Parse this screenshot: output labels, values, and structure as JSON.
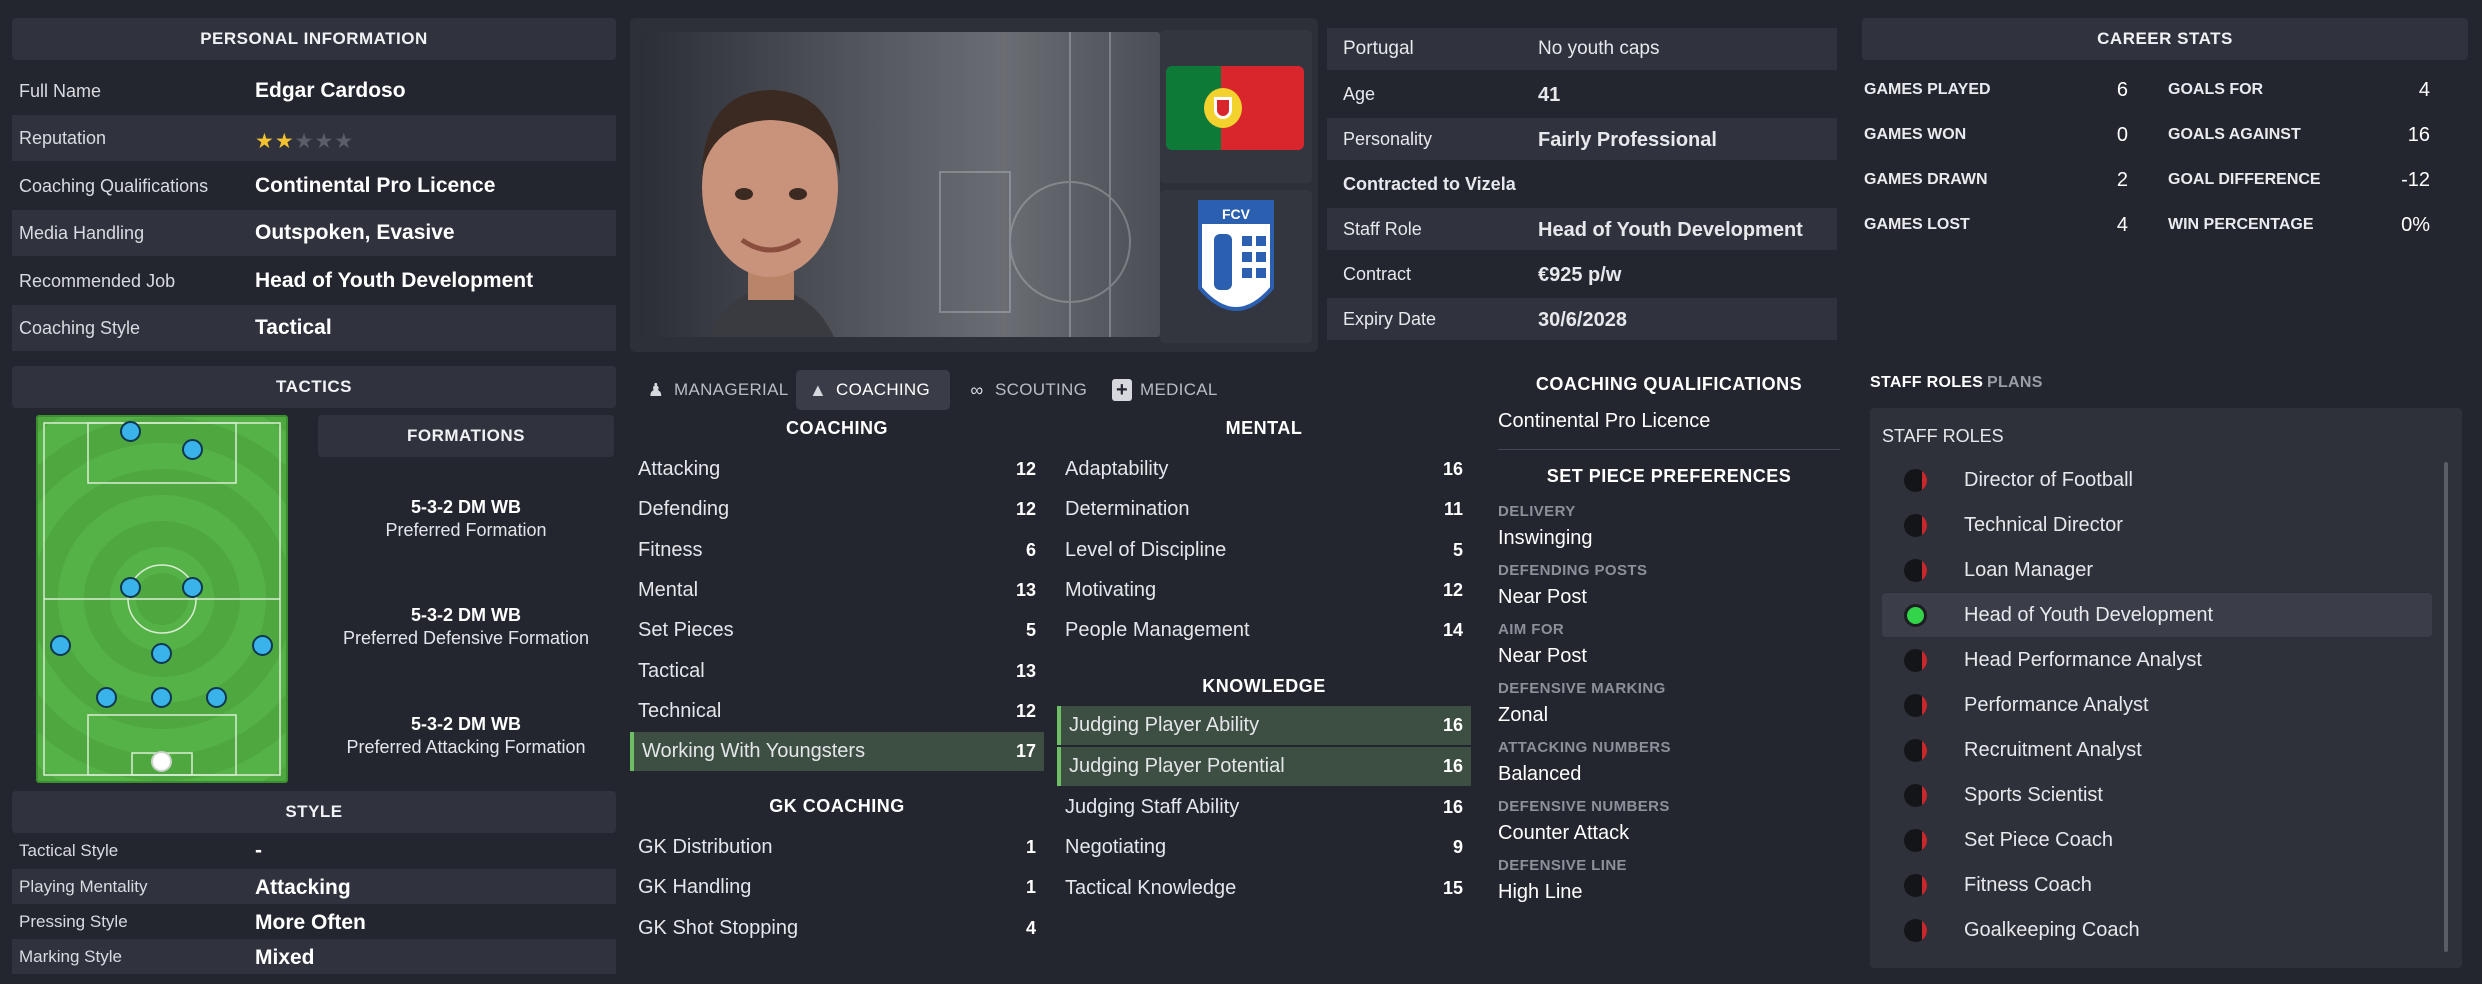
{
  "personal": {
    "header": "PERSONAL INFORMATION",
    "rows": [
      {
        "label": "Full Name",
        "value": "Edgar Cardoso"
      },
      {
        "label": "Reputation",
        "stars_filled": 2,
        "stars_total": 5
      },
      {
        "label": "Coaching Qualifications",
        "value": "Continental Pro Licence"
      },
      {
        "label": "Media Handling",
        "value": "Outspoken, Evasive"
      },
      {
        "label": "Recommended Job",
        "value": "Head of Youth Development"
      },
      {
        "label": "Coaching Style",
        "value": "Tactical"
      }
    ]
  },
  "profile": {
    "flag_colors": {
      "green": "#0e7a37",
      "red": "#d9262c"
    },
    "club_badge": "vizela-crest-icon"
  },
  "details": {
    "nation": "Portugal",
    "youth_caps": "No youth caps",
    "age_label": "Age",
    "age": "41",
    "personality_label": "Personality",
    "personality": "Fairly Professional",
    "contracted": "Contracted to Vizela",
    "role_label": "Staff Role",
    "role": "Head of Youth Development",
    "contract_label": "Contract",
    "contract": "€925 p/w",
    "expiry_label": "Expiry Date",
    "expiry": "30/6/2028"
  },
  "career": {
    "header": "CAREER STATS",
    "left": [
      {
        "label": "GAMES PLAYED",
        "value": "6"
      },
      {
        "label": "GAMES WON",
        "value": "0"
      },
      {
        "label": "GAMES DRAWN",
        "value": "2"
      },
      {
        "label": "GAMES LOST",
        "value": "4"
      }
    ],
    "right": [
      {
        "label": "GOALS FOR",
        "value": "4"
      },
      {
        "label": "GOALS AGAINST",
        "value": "16"
      },
      {
        "label": "GOAL DIFFERENCE",
        "value": "-12"
      },
      {
        "label": "WIN PERCENTAGE",
        "value": "0%"
      }
    ]
  },
  "tactics": {
    "header": "TACTICS",
    "formations_header": "FORMATIONS",
    "formations": [
      {
        "name": "5-3-2 DM WB",
        "desc": "Preferred Formation"
      },
      {
        "name": "5-3-2 DM WB",
        "desc": "Preferred Defensive Formation"
      },
      {
        "name": "5-3-2 DM WB",
        "desc": "Preferred Attacking Formation"
      }
    ],
    "pitch_color": "#4ea83f"
  },
  "style": {
    "header": "STYLE",
    "rows": [
      {
        "label": "Tactical Style",
        "value": "-"
      },
      {
        "label": "Playing Mentality",
        "value": "Attacking"
      },
      {
        "label": "Pressing Style",
        "value": "More Often"
      },
      {
        "label": "Marking Style",
        "value": "Mixed"
      }
    ]
  },
  "tabs": [
    {
      "label": "MANAGERIAL",
      "icon": "manager-icon"
    },
    {
      "label": "COACHING",
      "icon": "coach-icon",
      "active": true
    },
    {
      "label": "SCOUTING",
      "icon": "binoculars-icon"
    },
    {
      "label": "MEDICAL",
      "icon": "medical-kit-icon"
    }
  ],
  "attributes": {
    "coaching_header": "COACHING",
    "coaching": [
      {
        "label": "Attacking",
        "value": "12",
        "tone": "b"
      },
      {
        "label": "Defending",
        "value": "12",
        "tone": "b"
      },
      {
        "label": "Fitness",
        "value": "6",
        "tone": "w"
      },
      {
        "label": "Mental",
        "value": "13",
        "tone": "b"
      },
      {
        "label": "Set Pieces",
        "value": "5",
        "tone": "g"
      },
      {
        "label": "Tactical",
        "value": "13",
        "tone": "b"
      },
      {
        "label": "Technical",
        "value": "12",
        "tone": "b"
      },
      {
        "label": "Working With Youngsters",
        "value": "17",
        "tone": "w",
        "hl": true
      }
    ],
    "gk_header": "GK COACHING",
    "gk": [
      {
        "label": "GK Distribution",
        "value": "1",
        "tone": "g"
      },
      {
        "label": "GK Handling",
        "value": "1",
        "tone": "g"
      },
      {
        "label": "GK Shot Stopping",
        "value": "4",
        "tone": "g"
      }
    ],
    "mental_header": "MENTAL",
    "mental": [
      {
        "label": "Adaptability",
        "value": "16",
        "tone": "b"
      },
      {
        "label": "Determination",
        "value": "11",
        "tone": "b"
      },
      {
        "label": "Level of Discipline",
        "value": "5",
        "tone": "g"
      },
      {
        "label": "Motivating",
        "value": "12",
        "tone": "b"
      },
      {
        "label": "People Management",
        "value": "14",
        "tone": "b"
      }
    ],
    "knowledge_header": "KNOWLEDGE",
    "knowledge": [
      {
        "label": "Judging Player Ability",
        "value": "16",
        "tone": "b",
        "hl": true
      },
      {
        "label": "Judging Player Potential",
        "value": "16",
        "tone": "b",
        "hl": true
      },
      {
        "label": "Judging Staff Ability",
        "value": "16",
        "tone": "b"
      },
      {
        "label": "Negotiating",
        "value": "9",
        "tone": "w"
      },
      {
        "label": "Tactical Knowledge",
        "value": "15",
        "tone": "b"
      }
    ]
  },
  "qualifications": {
    "header": "COACHING QUALIFICATIONS",
    "value": "Continental Pro Licence",
    "setpiece_header": "SET PIECE PREFERENCES",
    "items": [
      {
        "label": "DELIVERY",
        "value": "Inswinging"
      },
      {
        "label": "DEFENDING POSTS",
        "value": "Near Post"
      },
      {
        "label": "AIM FOR",
        "value": "Near Post"
      },
      {
        "label": "DEFENSIVE MARKING",
        "value": "Zonal"
      },
      {
        "label": "ATTACKING NUMBERS",
        "value": "Balanced"
      },
      {
        "label": "DEFENSIVE NUMBERS",
        "value": "Counter Attack"
      },
      {
        "label": "DEFENSIVE LINE",
        "value": "High Line"
      }
    ]
  },
  "staff": {
    "tabs": [
      "STAFF ROLES",
      "PLANS"
    ],
    "header": "STAFF ROLES",
    "roles": [
      {
        "label": "Director of Football",
        "ok": false
      },
      {
        "label": "Technical Director",
        "ok": false
      },
      {
        "label": "Loan Manager",
        "ok": false
      },
      {
        "label": "Head of Youth Development",
        "ok": true
      },
      {
        "label": "Head Performance Analyst",
        "ok": false
      },
      {
        "label": "Performance Analyst",
        "ok": false
      },
      {
        "label": "Recruitment Analyst",
        "ok": false
      },
      {
        "label": "Sports Scientist",
        "ok": false
      },
      {
        "label": "Set Piece Coach",
        "ok": false
      },
      {
        "label": "Fitness Coach",
        "ok": false
      },
      {
        "label": "Goalkeeping Coach",
        "ok": false
      }
    ]
  }
}
